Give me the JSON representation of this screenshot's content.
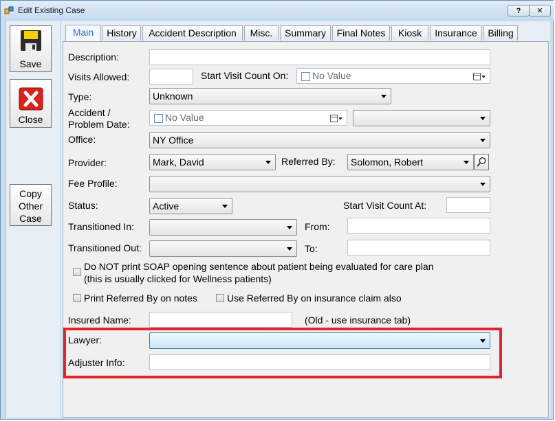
{
  "window": {
    "title": "Edit Existing Case",
    "help_label": "?",
    "close_label": "✕"
  },
  "sidebar": {
    "save": "Save",
    "close": "Close",
    "copy": [
      "Copy",
      "Other",
      "Case"
    ]
  },
  "tabs": [
    "Main",
    "History",
    "Accident Description",
    "Misc.",
    "Summary",
    "Final Notes",
    "Kiosk",
    "Insurance",
    "Billing"
  ],
  "form": {
    "description_label": "Description:",
    "visits_allowed_label": "Visits Allowed:",
    "start_visit_count_on_label": "Start Visit Count On:",
    "start_visit_count_on_value": "No Value",
    "type_label": "Type:",
    "type_value": "Unknown",
    "accident_label_line1": "Accident /",
    "accident_label_line2": "Problem Date:",
    "accident_date_value": "No Value",
    "office_label": "Office:",
    "office_value": "NY Office",
    "provider_label": "Provider:",
    "provider_value": "Mark, David",
    "referred_by_label": "Referred By:",
    "referred_by_value": "Solomon, Robert",
    "fee_profile_label": "Fee Profile:",
    "status_label": "Status:",
    "status_value": "Active",
    "start_visit_count_at_label": "Start Visit Count At:",
    "transitioned_in_label": "Transitioned In:",
    "from_label": "From:",
    "transitioned_out_label": "Transitioned Out:",
    "to_label": "To:",
    "soap_line1": "Do NOT print SOAP opening sentence about patient being evaluated for care plan",
    "soap_line2": "(this is usually clicked for Wellness patients)",
    "print_referred_label": "Print Referred By on notes",
    "use_referred_label": "Use Referred By on insurance claim also",
    "insured_name_label": "Insured Name:",
    "insured_note": "(Old - use insurance tab)",
    "lawyer_label": "Lawyer:",
    "adjuster_label": "Adjuster Info:"
  },
  "colors": {
    "highlight": "#e2242d",
    "active_tab": "#2b6fc0"
  }
}
